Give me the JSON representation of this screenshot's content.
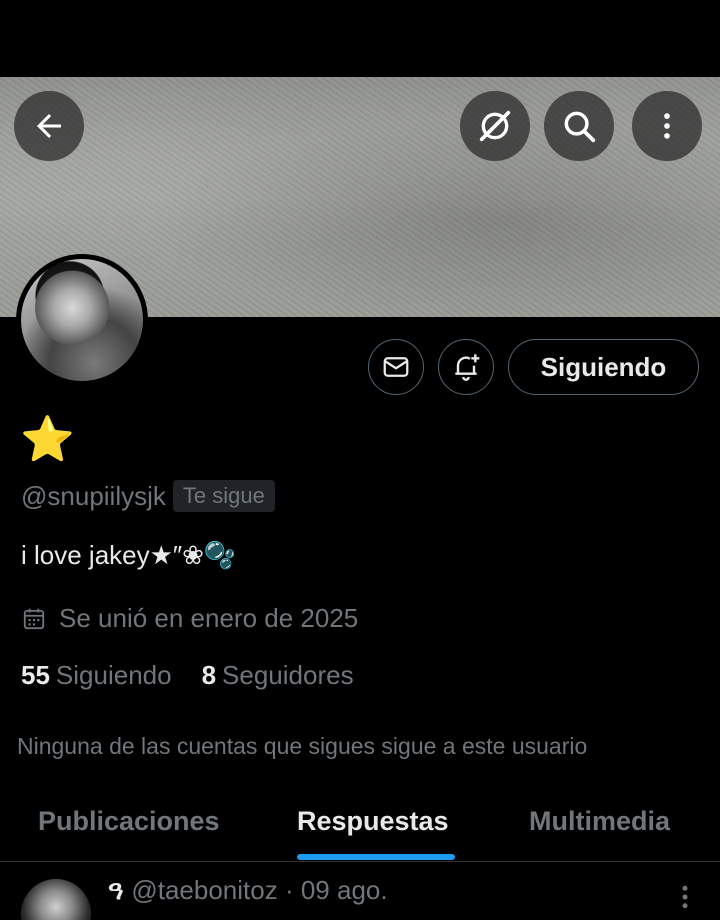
{
  "profile": {
    "display_name": "⭐",
    "handle": "@snupiilysjk",
    "follows_you": "Te sigue",
    "bio": "i love jakey★″❀🫧",
    "joined": "Se unió en enero de 2025",
    "following_count": "55",
    "following_label": "Siguiendo",
    "followers_count": "8",
    "followers_label": "Seguidores",
    "mutuals_note": "Ninguna de las cuentas que sigues sigue a este usuario"
  },
  "actions": {
    "follow_button": "Siguiendo"
  },
  "tabs": [
    {
      "label": "Publicaciones",
      "active": false
    },
    {
      "label": "Respuestas",
      "active": true
    },
    {
      "label": "Multimedia",
      "active": false
    }
  ],
  "post": {
    "name": "ዓ",
    "handle": "@taebonitoz",
    "date": "· 09 ago."
  },
  "colors": {
    "accent": "#1d9bf0",
    "text_primary": "#e7e9ea",
    "text_secondary": "#71767b",
    "border": "#536471",
    "background": "#000000"
  },
  "icons": [
    "back-arrow-icon",
    "grok-icon",
    "search-icon",
    "more-vertical-icon",
    "message-icon",
    "notification-bell-plus-icon",
    "calendar-icon"
  ]
}
